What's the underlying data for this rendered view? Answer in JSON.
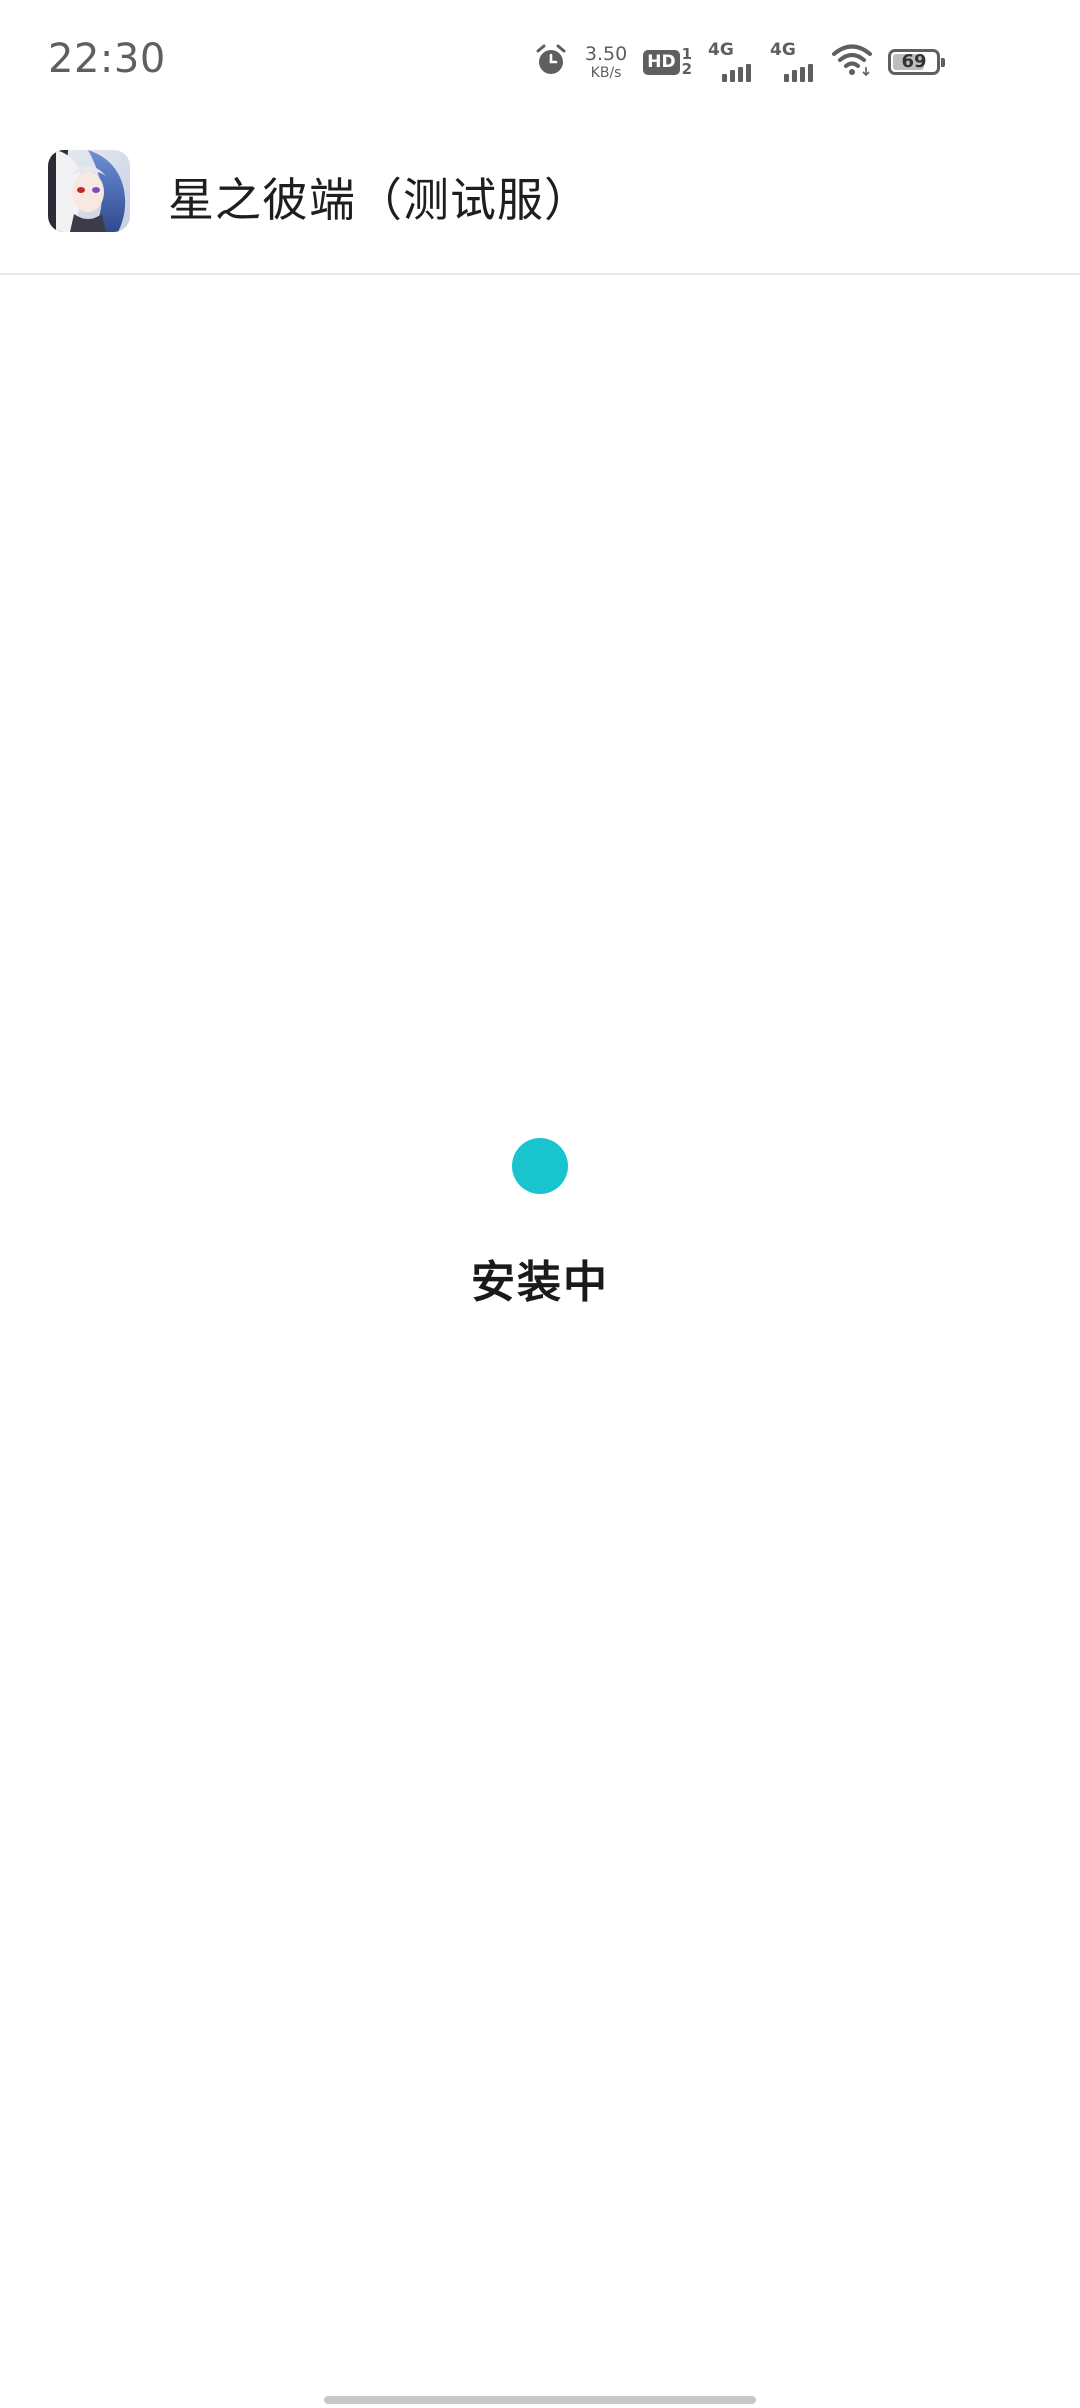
{
  "status_bar": {
    "time": "22:30",
    "net_speed_value": "3.50",
    "net_speed_unit": "KB/s",
    "hd_label": "HD",
    "hd_sub_top": "1",
    "hd_sub_bottom": "2",
    "sim1_label": "4G",
    "sim2_label": "4G",
    "battery_level": "69",
    "icons": [
      "alarm-icon",
      "wifi-icon",
      "battery-icon",
      "signal-icon"
    ]
  },
  "app": {
    "title": "星之彼端（测试服）",
    "icon": "app-icon"
  },
  "install": {
    "status_text": "安装中",
    "accent_color": "#18c5cf"
  }
}
